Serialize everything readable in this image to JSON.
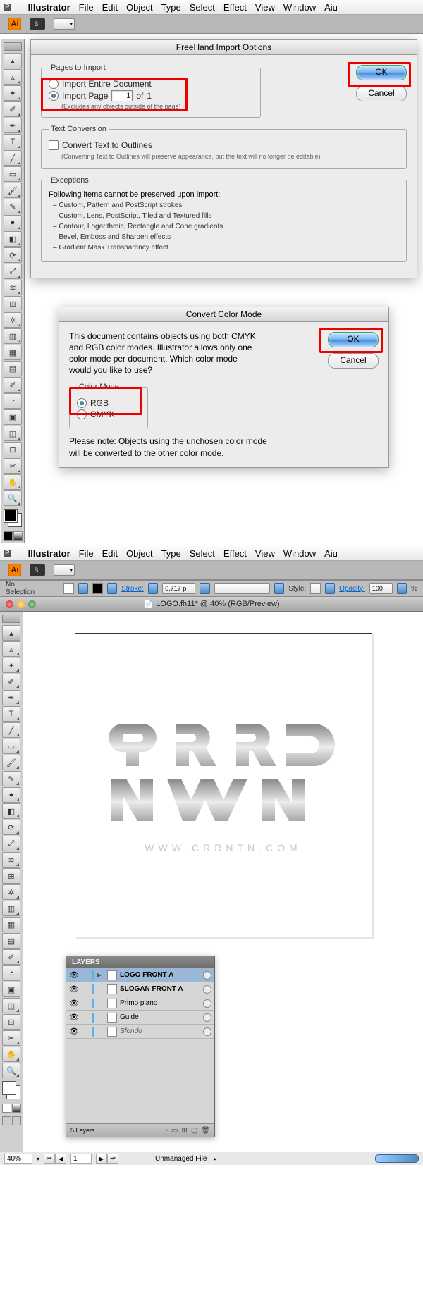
{
  "menu": {
    "app": "Illustrator",
    "items": [
      "File",
      "Edit",
      "Object",
      "Type",
      "Select",
      "Effect",
      "View",
      "Window",
      "Aiu"
    ]
  },
  "dialog1": {
    "title": "FreeHand Import Options",
    "pages_legend": "Pages to Import",
    "import_entire": "Import Entire Document",
    "import_page": "Import Page",
    "page_value": "1",
    "of": "of",
    "total": "1",
    "excludes": "(Excludes any objects outside of the page)",
    "text_legend": "Text Conversion",
    "convert_text": "Convert Text to Outlines",
    "convert_note": "(Converting Text to Outlines will preserve appearance, but the text will no longer be editable)",
    "exc_legend": "Exceptions",
    "exc_intro": "Following items cannot be preserved upon import:",
    "exc_items": [
      "– Custom, Pattern and PostScript strokes",
      "– Custom, Lens, PostScript, Tiled and Textured fills",
      "– Contour, Logarithmic, Rectangle and Cone gradients",
      "– Bevel, Emboss and Sharpen effects",
      "– Gradient Mask Transparency effect"
    ],
    "ok": "OK",
    "cancel": "Cancel"
  },
  "dialog2": {
    "title": "Convert Color Mode",
    "body": "This document contains objects using both CMYK and RGB color modes.  Illustrator allows only one color mode per document.  Which color mode would you like to use?",
    "mode_legend": "Color Mode",
    "rgb": "RGB",
    "cmyk": "CMYK",
    "note": "Please note: Objects using the unchosen color mode will be converted to the other color mode.",
    "ok": "OK",
    "cancel": "Cancel"
  },
  "options": {
    "no_sel": "No Selection",
    "stroke": "Stroke:",
    "stroke_val": "0,717 p",
    "style": "Style:",
    "opacity": "Opacity:",
    "opacity_val": "100",
    "pct": "%"
  },
  "doc": {
    "title": "LOGO.fh11* @ 40% (RGB/Preview)"
  },
  "logo_url": "WWW.CRRNTN.COM",
  "layers": {
    "tab": "LAYERS",
    "items": [
      {
        "name": "LOGO FRONT A",
        "bold": true,
        "sel": true,
        "tw": true
      },
      {
        "name": "SLOGAN FRONT A",
        "bold": true
      },
      {
        "name": "Primo piano"
      },
      {
        "name": "Guide"
      },
      {
        "name": "Sfondo",
        "italic": true
      }
    ],
    "footer": "5 Layers"
  },
  "status": {
    "zoom": "40%",
    "page": "1",
    "file": "Unmanaged File"
  }
}
